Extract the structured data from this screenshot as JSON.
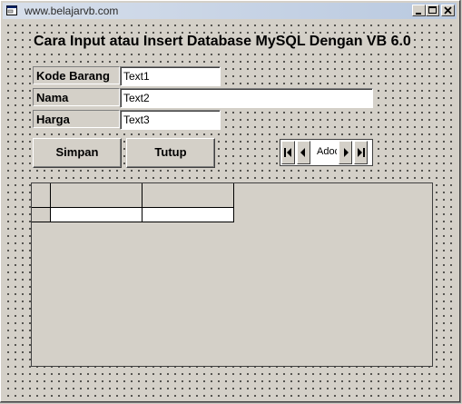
{
  "window": {
    "title": "www.belajarvb.com",
    "minimize_label": "_",
    "maximize_label": "□",
    "close_label": "×"
  },
  "form": {
    "heading": "Cara Input atau Insert Database MySQL Dengan VB 6.0",
    "fields": [
      {
        "label": "Kode Barang",
        "value": "Text1"
      },
      {
        "label": "Nama",
        "value": "Text2"
      },
      {
        "label": "Harga",
        "value": "Text3"
      }
    ],
    "buttons": {
      "save_label": "Simpan",
      "close_label": "Tutup"
    },
    "ado": {
      "caption": "Adodc"
    }
  }
}
